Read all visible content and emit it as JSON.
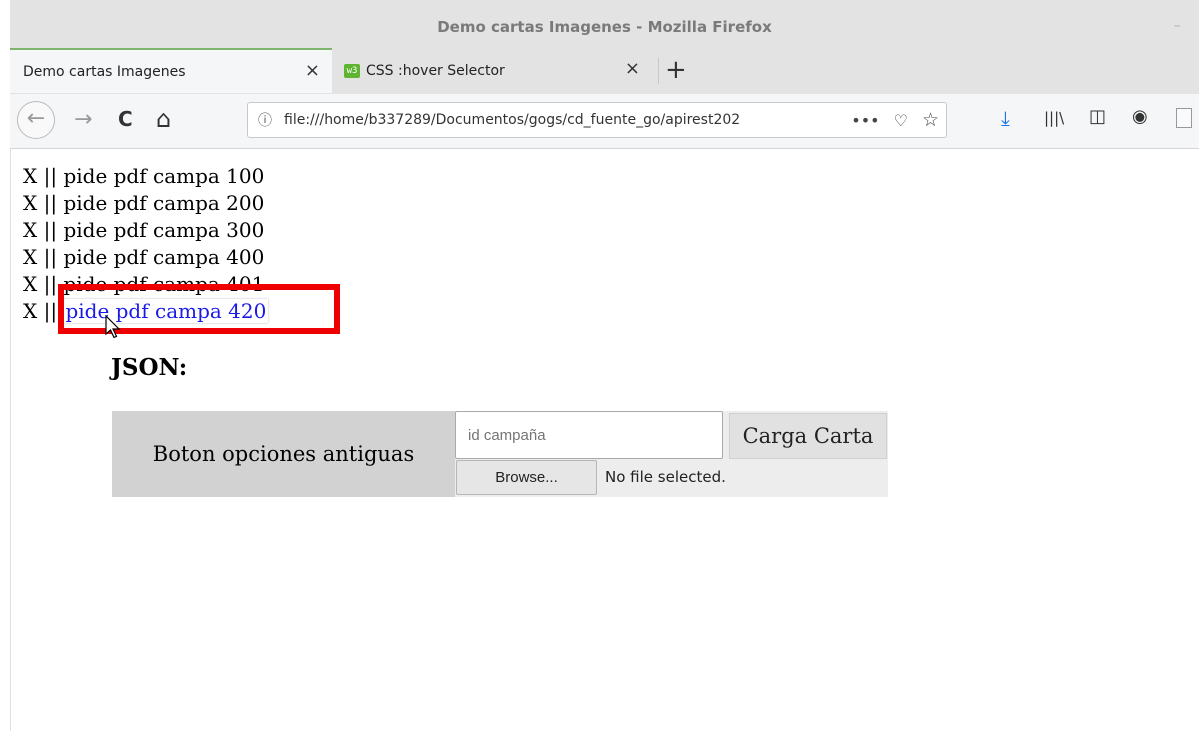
{
  "window": {
    "title": "Demo cartas Imagenes - Mozilla Firefox",
    "control": "–"
  },
  "tabs": [
    {
      "label": "Demo cartas Imagenes",
      "close": "×"
    },
    {
      "label": "CSS :hover Selector",
      "close": "×",
      "favicon": "w3"
    }
  ],
  "newtab": "+",
  "nav": {
    "back": "←",
    "forward": "→",
    "reload": "C",
    "home": "⌂",
    "info": "ⓘ",
    "url": "file:///home/b337289/Documentos/gogs/cd_fuente_go/apirest202",
    "more": "•••",
    "pocket": "♡",
    "bookmark": "☆",
    "downloads": "⤓",
    "library": "|||\\",
    "sidebar": "◫",
    "account": "◉"
  },
  "list": [
    {
      "prefix": "X || ",
      "link": "pide pdf campa 100"
    },
    {
      "prefix": "X || ",
      "link": "pide pdf campa 200"
    },
    {
      "prefix": "X || ",
      "link": "pide pdf campa 300"
    },
    {
      "prefix": "X || ",
      "link": "pide pdf campa 400"
    },
    {
      "prefix": "X || ",
      "link": "pide pdf campa 401"
    },
    {
      "prefix": "X || ",
      "link": "pide pdf campa 420"
    }
  ],
  "json_heading": "JSON:",
  "panel": {
    "old_button": "Boton opciones antiguas",
    "id_placeholder": "id campaña",
    "carga_button": "Carga Carta",
    "browse_button": "Browse...",
    "no_file": "No file selected."
  },
  "colors": {
    "highlight": "#ee0000",
    "link_hover": "#1a1ae6",
    "tab_accent": "#7fb46d"
  }
}
